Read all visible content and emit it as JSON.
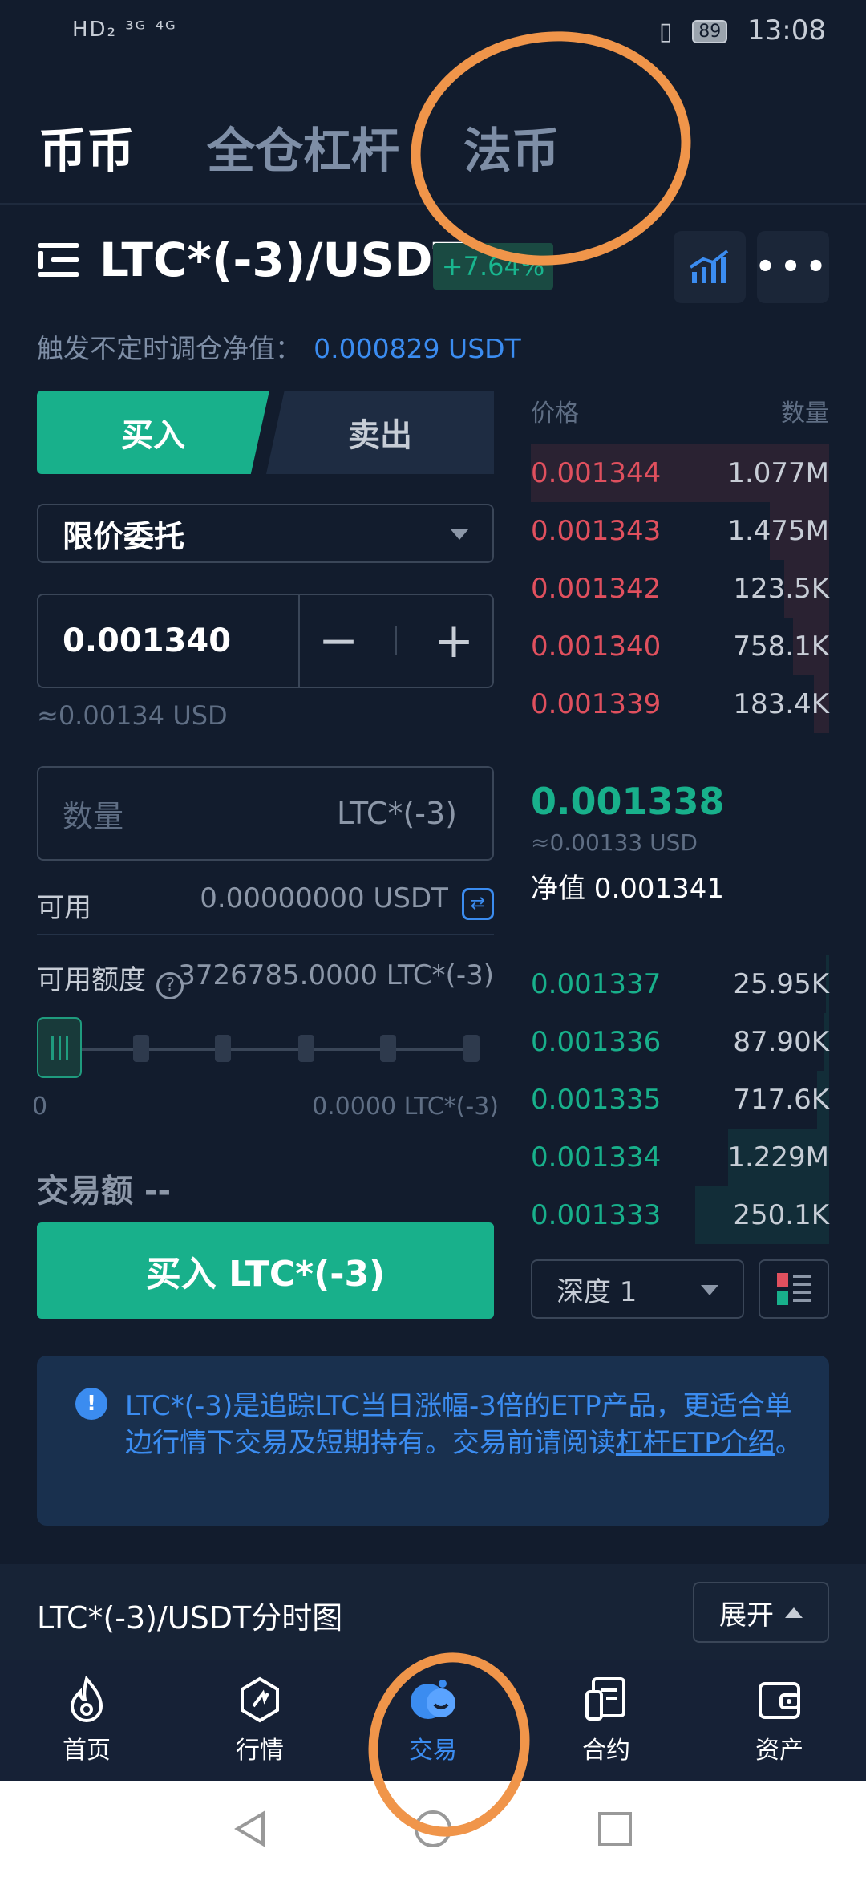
{
  "status_bar": {
    "left": "HD₂ ³ᴳ ⁴ᴳ",
    "battery": "89",
    "time": "13:08"
  },
  "top_tabs": [
    {
      "label": "币币",
      "active": true
    },
    {
      "label": "全仓杠杆",
      "active": false
    },
    {
      "label": "法币",
      "active": false
    }
  ],
  "pair": {
    "name": "LTC*(-3)/USDT",
    "change": "+7.64%"
  },
  "nav": {
    "label": "触发不定时调仓净值：",
    "value": "0.000829 USDT"
  },
  "trade": {
    "buy_label": "买入",
    "sell_label": "卖出",
    "order_type": "限价委托",
    "price_value": "0.001340",
    "price_approx": "≈0.00134 USD",
    "qty_placeholder": "数量",
    "qty_unit": "LTC*(-3)",
    "available_label": "可用",
    "available_value": "0.00000000 USDT",
    "limit_label": "可用额度",
    "limit_value": "3726785.0000 LTC*(-3)",
    "slider_min": "0",
    "slider_max": "0.0000 LTC*(-3)",
    "amount_label": "交易额 --",
    "submit_label": "买入 LTC*(-3)"
  },
  "orderbook": {
    "price_header": "价格",
    "qty_header": "数量",
    "asks": [
      {
        "price": "0.001344",
        "qty": "1.077M",
        "depth": 1.0
      },
      {
        "price": "0.001343",
        "qty": "1.475M",
        "depth": 0.2
      },
      {
        "price": "0.001342",
        "qty": "123.5K",
        "depth": 0.15
      },
      {
        "price": "0.001340",
        "qty": "758.1K",
        "depth": 0.12
      },
      {
        "price": "0.001339",
        "qty": "183.4K",
        "depth": 0.05
      }
    ],
    "last_price": "0.001338",
    "last_approx": "≈0.00133 USD",
    "net_value": "净值 0.001341",
    "bids": [
      {
        "price": "0.001337",
        "qty": "25.95K",
        "depth": 0.01
      },
      {
        "price": "0.001336",
        "qty": "87.90K",
        "depth": 0.02
      },
      {
        "price": "0.001335",
        "qty": "717.6K",
        "depth": 0.04
      },
      {
        "price": "0.001334",
        "qty": "1.229M",
        "depth": 0.34
      },
      {
        "price": "0.001333",
        "qty": "250.1K",
        "depth": 0.45
      }
    ],
    "depth_label": "深度 1"
  },
  "notice": {
    "text": "LTC*(-3)是追踪LTC当日涨幅-3倍的ETP产品，更适合单边行情下交易及短期持有。交易前请阅读",
    "link": "杠杆ETP介绍",
    "end": "。"
  },
  "chart_bar": {
    "title": "LTC*(-3)/USDT分时图",
    "expand_label": "展开"
  },
  "bottom_nav": [
    {
      "label": "首页",
      "icon": "flame-icon"
    },
    {
      "label": "行情",
      "icon": "market-icon"
    },
    {
      "label": "交易",
      "icon": "trade-icon",
      "active": true
    },
    {
      "label": "合约",
      "icon": "contract-icon"
    },
    {
      "label": "资产",
      "icon": "wallet-icon"
    }
  ],
  "colors": {
    "buy": "#18b08b",
    "sell": "#e0505e",
    "accent": "#3b8cf0",
    "annotation": "#f0954a"
  }
}
